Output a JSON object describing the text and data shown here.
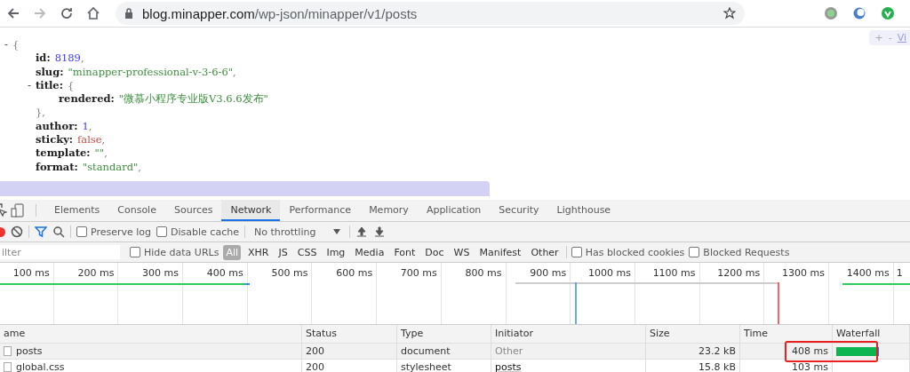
{
  "browser": {
    "url_host": "blog.minapper.com",
    "url_path": "/wp-json/minapper/v1/posts"
  },
  "viewer_controls": {
    "expand": "+",
    "collapse": "-",
    "view_link": "Vi"
  },
  "json_tree": [
    {
      "toggle": "-",
      "open": "{",
      "children": [
        {
          "key": "id:",
          "value": "8189",
          "kind": "number",
          "punct": ","
        },
        {
          "key": "slug:",
          "value": "\"minapper-professional-v-3-6-6\"",
          "kind": "string",
          "punct": ","
        },
        {
          "toggle": "-",
          "key": "title:",
          "open": "{",
          "close": "},",
          "children": [
            {
              "key": "rendered:",
              "value": "\"微慕小程序专业版V3.6.6发布\"",
              "kind": "string"
            }
          ]
        },
        {
          "key": "author:",
          "value": "1",
          "kind": "number",
          "punct": ","
        },
        {
          "key": "sticky:",
          "value": "false",
          "kind": "bool",
          "punct": ","
        },
        {
          "key": "template:",
          "value": "\"\"",
          "kind": "string",
          "punct": ","
        },
        {
          "key": "format:",
          "value": "\"standard\"",
          "kind": "string",
          "punct": ","
        }
      ]
    }
  ],
  "devtools": {
    "tabs": [
      {
        "label": "Elements",
        "selected": false
      },
      {
        "label": "Console",
        "selected": false
      },
      {
        "label": "Sources",
        "selected": false
      },
      {
        "label": "Network",
        "selected": true
      },
      {
        "label": "Performance",
        "selected": false
      },
      {
        "label": "Memory",
        "selected": false
      },
      {
        "label": "Application",
        "selected": false
      },
      {
        "label": "Security",
        "selected": false
      },
      {
        "label": "Lighthouse",
        "selected": false
      }
    ],
    "toolbar": {
      "recording": true,
      "preserve_log": {
        "label": "Preserve log",
        "checked": false
      },
      "disable_cache": {
        "label": "Disable cache",
        "checked": false
      },
      "throttling": "No throttling"
    },
    "filter": {
      "placeholder": "ilter",
      "hide_data_urls": {
        "label": "Hide data URLs",
        "checked": false
      },
      "types": [
        {
          "label": "All",
          "selected": true
        },
        {
          "label": "XHR",
          "selected": false
        },
        {
          "label": "JS",
          "selected": false
        },
        {
          "label": "CSS",
          "selected": false
        },
        {
          "label": "Img",
          "selected": false
        },
        {
          "label": "Media",
          "selected": false
        },
        {
          "label": "Font",
          "selected": false
        },
        {
          "label": "Doc",
          "selected": false
        },
        {
          "label": "WS",
          "selected": false
        },
        {
          "label": "Manifest",
          "selected": false
        },
        {
          "label": "Other",
          "selected": false
        }
      ],
      "has_blocked_cookies": {
        "label": "Has blocked cookies",
        "checked": false
      },
      "blocked_requests": {
        "label": "Blocked Requests",
        "checked": false
      }
    },
    "timeline": {
      "ticks": [
        "100 ms",
        "200 ms",
        "300 ms",
        "400 ms",
        "500 ms",
        "600 ms",
        "700 ms",
        "800 ms",
        "900 ms",
        "1000 ms",
        "1100 ms",
        "1200 ms",
        "1300 ms",
        "1400 ms",
        "1"
      ]
    },
    "table": {
      "columns": [
        "ame",
        "Status",
        "Type",
        "Initiator",
        "Size",
        "Time",
        "Waterfall"
      ],
      "rows": [
        {
          "name": "posts",
          "status": "200",
          "type": "document",
          "initiator": "Other",
          "initiator_link": false,
          "size": "23.2 kB",
          "time": "408 ms",
          "hovered": true
        },
        {
          "name": "global.css",
          "status": "200",
          "type": "stylesheet",
          "initiator": "posts",
          "initiator_link": true,
          "size": "15.8 kB",
          "time": "103 ms",
          "hovered": false
        }
      ]
    }
  }
}
